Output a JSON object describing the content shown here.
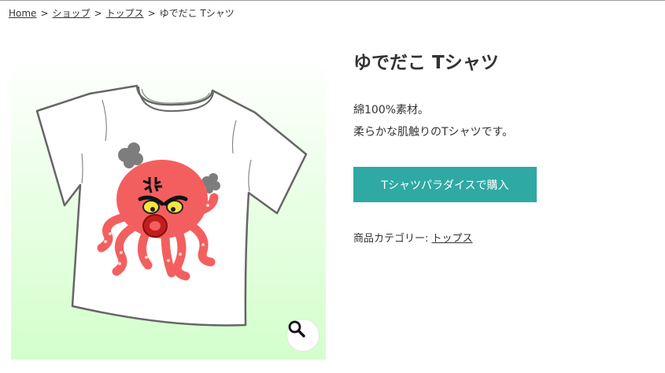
{
  "breadcrumb": {
    "items": [
      "Home",
      "ショップ",
      "トップス"
    ],
    "separator": ">",
    "current": "ゆでだこ Tシャツ"
  },
  "product": {
    "title": "ゆでだこ Tシャツ",
    "description": [
      "綿100%素材。",
      "柔らかな肌触りのTシャツです。"
    ],
    "buy_label": "Tシャツパラダイスで購入",
    "category_label": "商品カテゴリー:",
    "category_value": "トップス",
    "image_icon": "angry-octopus-tshirt",
    "zoom_icon": "magnifier-icon"
  },
  "colors": {
    "accent": "#2fa9a4",
    "octopus": "#f35f5f",
    "background_gradient_end": "#d3ffcc"
  }
}
